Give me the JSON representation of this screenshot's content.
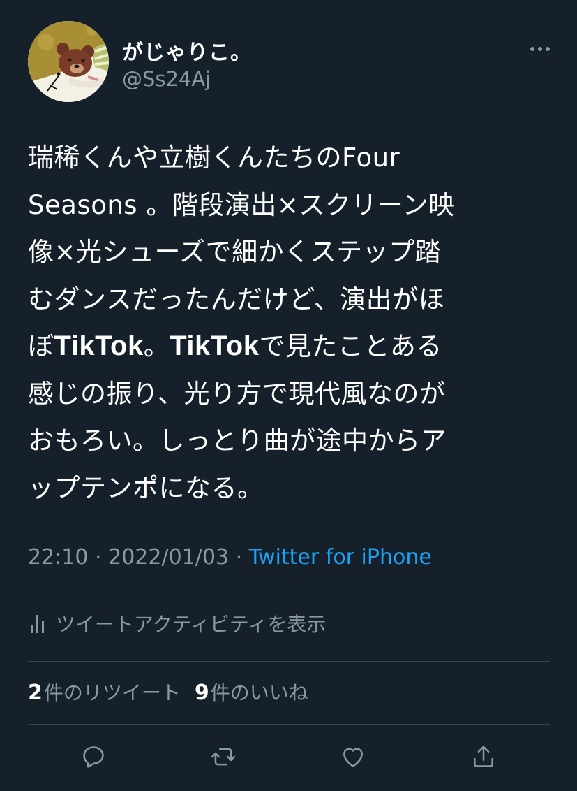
{
  "user": {
    "display_name": "がじゃりこ。",
    "handle": "@Ss24Aj",
    "avatar_icon": "bear-avatar-icon"
  },
  "tweet": {
    "lines": [
      [
        "瑞稀くんや立樹くんたちのFour",
        "",
        ""
      ],
      [
        "Seasons 。階段演出×スクリーン映",
        "",
        ""
      ],
      [
        "像×光シューズで細かくステップ踏",
        "",
        ""
      ],
      [
        "むダンスだったんだけど、演出がほ",
        "",
        ""
      ],
      [
        "ぼ",
        "TikTok",
        "。"
      ],
      [
        "感じの振り、光り方で現代風なのが",
        "",
        ""
      ],
      [
        "おもろい。しっとり曲が途中からア",
        "",
        ""
      ],
      [
        "ップテンポになる。",
        "",
        ""
      ]
    ],
    "line5_bold2": "TikTok",
    "line5_rest": "で見たことある"
  },
  "meta": {
    "time": "22:10",
    "date": "2022/01/03",
    "separator": "·",
    "source": "Twitter for iPhone"
  },
  "activity": {
    "label": "ツイートアクティビティを表示",
    "icon": "bar-chart-icon"
  },
  "stats": {
    "retweets_count": "2",
    "retweets_label": "件のリツイート",
    "likes_count": "9",
    "likes_label": "件のいいね"
  },
  "colors": {
    "background": "#15202b",
    "text": "#ffffff",
    "secondary": "#8899a6",
    "accent": "#1da1f2",
    "divider": "#38444d"
  },
  "actions": {
    "icons": [
      "reply-icon",
      "retweet-icon",
      "like-icon",
      "share-icon"
    ]
  }
}
